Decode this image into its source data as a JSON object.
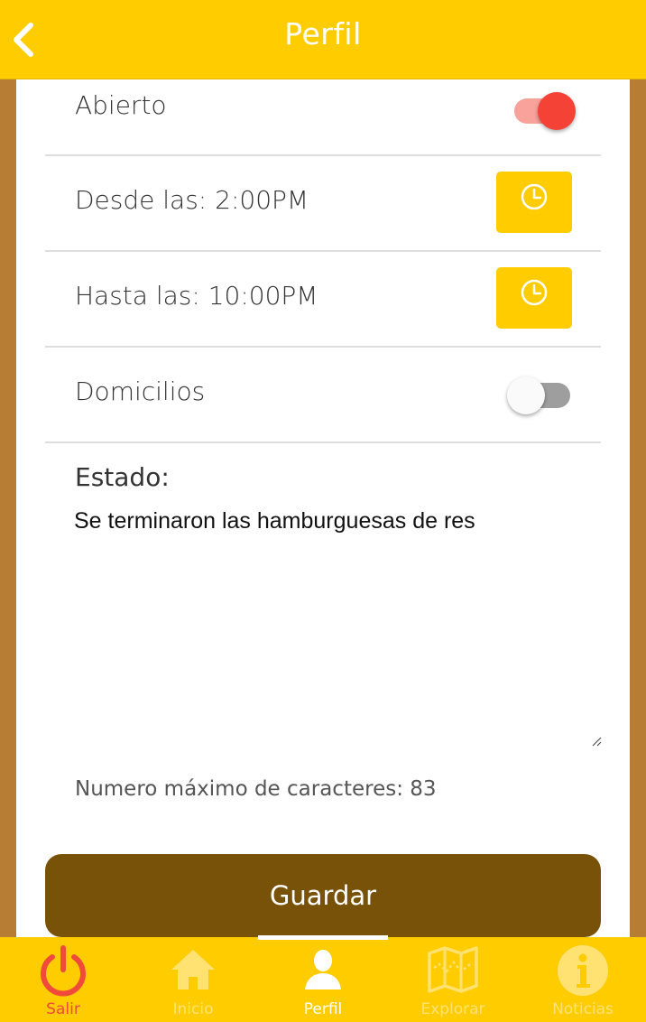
{
  "header": {
    "title": "Perfil",
    "back_icon": "chevron-left-icon"
  },
  "settings": {
    "abierto": {
      "label": "Abierto",
      "enabled": true
    },
    "desde": {
      "label": "Desde las: 2:00PM",
      "icon": "clock-icon"
    },
    "hasta": {
      "label": "Hasta las: 10:00PM",
      "icon": "clock-icon"
    },
    "domicilios": {
      "label": "Domicilios",
      "enabled": false
    }
  },
  "estado": {
    "label": "Estado:",
    "value": "Se terminaron las hamburguesas de res",
    "max_chars_text": "Numero máximo de caracteres: 83"
  },
  "save_button": {
    "label": "Guardar"
  },
  "bottom_nav": {
    "items": [
      {
        "label": "Salir",
        "icon": "power-icon",
        "color": "#f04a3a"
      },
      {
        "label": "Inicio",
        "icon": "home-icon",
        "color": "#ffe272"
      },
      {
        "label": "Perfil",
        "icon": "user-icon",
        "color": "#ffffff",
        "active": true
      },
      {
        "label": "Explorar",
        "icon": "map-icon",
        "color": "#ffe272"
      },
      {
        "label": "Noticias",
        "icon": "info-icon",
        "color": "#ffe272"
      }
    ]
  },
  "colors": {
    "primary": "#ffcc00",
    "background": "#b87d35",
    "save_button": "#785208",
    "toggle_on": "#f44336",
    "toggle_on_track": "#f8a29b",
    "toggle_off_track": "#9e9e9e"
  }
}
